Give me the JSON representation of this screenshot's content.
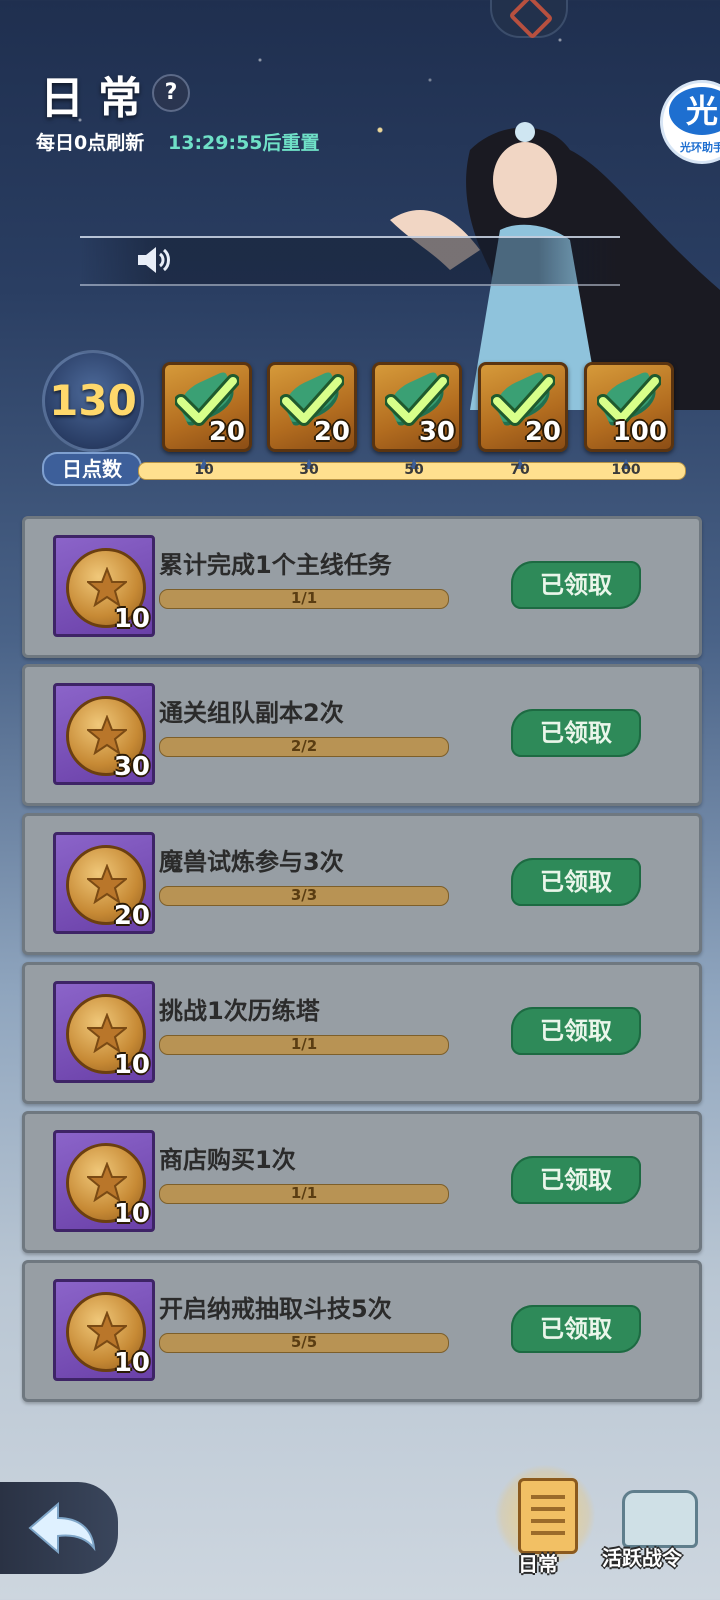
{
  "header": {
    "title": "日常",
    "help_label": "?",
    "refresh_text": "每日0点刷新",
    "timer_text": "13:29:55后重置"
  },
  "assistant_badge": {
    "glyph": "光",
    "label": "光环助手"
  },
  "score": {
    "value": "130",
    "label": "日点数"
  },
  "milestones": [
    {
      "points": "20",
      "threshold": "10",
      "claimed": true
    },
    {
      "points": "20",
      "threshold": "30",
      "claimed": true
    },
    {
      "points": "30",
      "threshold": "50",
      "claimed": true
    },
    {
      "points": "20",
      "threshold": "70",
      "claimed": true
    },
    {
      "points": "100",
      "threshold": "100",
      "claimed": true
    }
  ],
  "tasks": [
    {
      "name": "累计完成1个主线任务",
      "reward": "10",
      "progress": "1/1",
      "status": "已领取"
    },
    {
      "name": "通关组队副本2次",
      "reward": "30",
      "progress": "2/2",
      "status": "已领取"
    },
    {
      "name": "魔兽试炼参与3次",
      "reward": "20",
      "progress": "3/3",
      "status": "已领取"
    },
    {
      "name": "挑战1次历练塔",
      "reward": "10",
      "progress": "1/1",
      "status": "已领取"
    },
    {
      "name": "商店购买1次",
      "reward": "10",
      "progress": "1/1",
      "status": "已领取"
    },
    {
      "name": "开启纳戒抽取斗技5次",
      "reward": "10",
      "progress": "5/5",
      "status": "已领取"
    }
  ],
  "bottom_nav": {
    "daily_label": "日常",
    "pass_label": "活跃战令"
  },
  "colors": {
    "timer": "#6fe0c7",
    "score": "#ffd86b",
    "claimed_button": "#2e8a59",
    "task_card": "#979ea4"
  }
}
